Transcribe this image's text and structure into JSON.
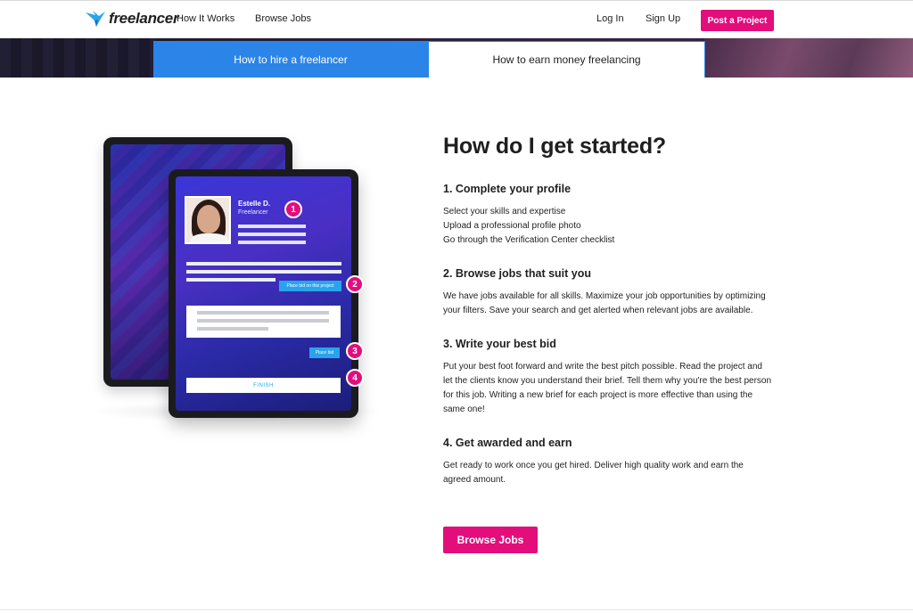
{
  "header": {
    "logo_text": "freelancer",
    "nav": {
      "how_it_works": "How It Works",
      "browse_jobs": "Browse Jobs"
    },
    "login": "Log In",
    "signup": "Sign Up",
    "post_project": "Post a Project"
  },
  "tabs": {
    "hire": "How to hire a freelancer",
    "earn": "How to earn money freelancing"
  },
  "illustration": {
    "name": "Estelle D.",
    "role": "Freelancer",
    "place_bid_project": "Place bid on this project",
    "place_bid": "Place bid",
    "finish": "FINISH",
    "badges": [
      "1",
      "2",
      "3",
      "4"
    ]
  },
  "main": {
    "heading": "How do I get started?",
    "steps": [
      {
        "title": "1. Complete your profile",
        "lines": [
          "Select your skills and expertise",
          "Upload a professional profile photo",
          "Go through the Verification Center checklist"
        ]
      },
      {
        "title": "2. Browse jobs that suit you",
        "body": "We have jobs available for all skills. Maximize your job opportunities by optimizing your filters. Save your search and get alerted when relevant jobs are available."
      },
      {
        "title": "3. Write your best bid",
        "body": "Put your best foot forward and write the best pitch possible. Read the project and let the clients know you understand their brief. Tell them why you're the best person for this job. Writing a new brief for each project is more effective than using the same one!"
      },
      {
        "title": "4. Get awarded and earn",
        "body": "Get ready to work once you get hired. Deliver high quality work and earn the agreed amount."
      }
    ],
    "cta": "Browse Jobs"
  },
  "colors": {
    "brand_pink": "#e30d7c",
    "tab_blue": "#2b84e8",
    "text": "#1f1f1f"
  }
}
